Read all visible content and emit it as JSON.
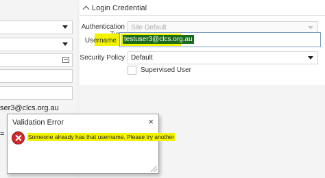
{
  "left_form": {
    "email_partial": "ser3@clcs.org.au",
    "partial_value": "= 1("
  },
  "login_credential": {
    "section_title": "Login Credential",
    "authentication_type": {
      "label": "Authentication Type",
      "value": "Site Default"
    },
    "username": {
      "label": "Username",
      "value": "testuser3@clcs.org.au"
    },
    "security_policy": {
      "label": "Security Policy",
      "value": "Default"
    },
    "supervised_user": {
      "label": "Supervised User",
      "checked": false
    }
  },
  "validation_dialog": {
    "title": "Validation Error",
    "close_symbol": "×",
    "message": "Someone already has that username. Please try another"
  },
  "colors": {
    "highlight": "#f3f300",
    "username_selection": "#1a6b1a",
    "error_icon": "#d22a2a"
  }
}
